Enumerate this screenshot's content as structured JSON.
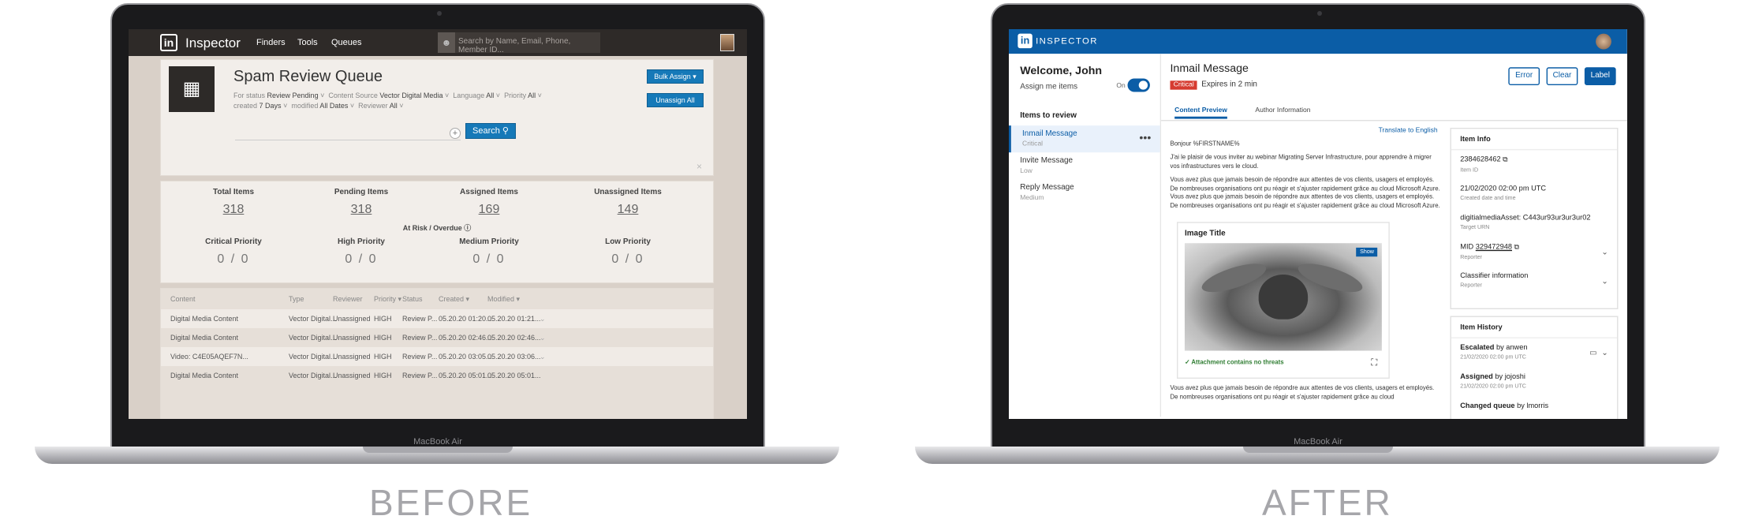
{
  "before": {
    "app_name": "Inspector",
    "logo_text": "in",
    "nav": [
      "Finders",
      "Tools",
      "Queues"
    ],
    "search_placeholder": "Search by Name, Email, Phone, Member ID...",
    "queue_title": "Spam Review Queue",
    "filters": {
      "for_status_label": "For status",
      "for_status_value": "Review Pending",
      "content_source_label": "Content Source",
      "content_source_value": "Vector Digital Media",
      "language_label": "Language",
      "language_value": "All",
      "priority_label": "Priority",
      "priority_value": "All",
      "created_label": "created",
      "created_value": "7 Days",
      "modified_label": "modified",
      "modified_value": "All Dates",
      "reviewer_label": "Reviewer",
      "reviewer_value": "All"
    },
    "search_button": "Search",
    "bulk_assign_button": "Bulk Assign",
    "unassign_all_button": "Unassign All",
    "close_icon": "×",
    "stats": [
      {
        "label": "Total Items",
        "value": "318"
      },
      {
        "label": "Pending Items",
        "value": "318"
      },
      {
        "label": "Assigned Items",
        "value": "169"
      },
      {
        "label": "Unassigned Items",
        "value": "149"
      }
    ],
    "risk_label": "At Risk / Overdue",
    "priorities": [
      {
        "label": "Critical Priority",
        "value": "0 / 0"
      },
      {
        "label": "High Priority",
        "value": "0 / 0"
      },
      {
        "label": "Medium Priority",
        "value": "0 / 0"
      },
      {
        "label": "Low Priority",
        "value": "0 / 0"
      }
    ],
    "table_headers": [
      "Content",
      "Type",
      "Reviewer",
      "Priority",
      "Status",
      "Created",
      "Modified"
    ],
    "rows": [
      [
        "Digital Media Content",
        "Vector Digital...",
        "Unassigned",
        "HIGH",
        "Review P...",
        "05.20.20 01:20...",
        "05.20.20 01:21..."
      ],
      [
        "Digital Media Content",
        "Vector Digital...",
        "Unassigned",
        "HIGH",
        "Review P...",
        "05.20.20 02:46...",
        "05.20.20 02:46..."
      ],
      [
        "Video: C4E05AQEF7N...",
        "Vector Digital...",
        "Unassigned",
        "HIGH",
        "Review P...",
        "05.20.20 03:05...",
        "05.20.20 03:06..."
      ],
      [
        "Digital Media Content",
        "Vector Digital...",
        "Unassigned",
        "HIGH",
        "Review P...",
        "05.20.20 05:01...",
        "05.20.20 05:01..."
      ]
    ],
    "laptop_label": "MacBook Air",
    "caption": "BEFORE"
  },
  "after": {
    "app_name": "INSPECTOR",
    "logo_text": "in",
    "welcome": "Welcome, John",
    "assign_me": "Assign me items",
    "toggle_label": "On",
    "items_to_review": "Items to review",
    "review_items": [
      {
        "title": "Inmail Message",
        "priority": "Critical"
      },
      {
        "title": "Invite Message",
        "priority": "Low"
      },
      {
        "title": "Reply Message",
        "priority": "Medium"
      }
    ],
    "more_icon": "•••",
    "message_title": "Inmail Message",
    "critical_badge": "Critical",
    "expires": "Expires in 2 min",
    "buttons": {
      "error": "Error",
      "clear": "Clear",
      "label": "Label"
    },
    "tabs": [
      "Content Preview",
      "Author Information"
    ],
    "translate": "Translate to English",
    "greeting": "Bonjour %FIRSTNAME%",
    "para1": "J'ai le plaisir de vous inviter au webinar Migrating Server Infrastructure, pour apprendre à migrer vos infrastructures vers le cloud.",
    "para2": "Vous avez plus que jamais besoin de répondre aux attentes de vos clients, usagers et employés. De nombreuses organisations ont pu réagir et s'ajuster rapidement grâce au cloud Microsoft Azure. Vous avez plus que jamais besoin de répondre aux attentes de vos clients, usagers et employés. De nombreuses organisations ont pu réagir et s'ajuster rapidement grâce au cloud Microsoft Azure.",
    "image_title": "Image Title",
    "show_button": "Show",
    "safe_text": "Attachment contains no threats",
    "para3": "Vous avez plus que jamais besoin de répondre aux attentes de vos clients, usagers et employés. De nombreuses organisations ont pu réagir et s'ajuster rapidement grâce au cloud",
    "item_info_title": "Item Info",
    "item_info": [
      {
        "value": "2384628462",
        "key": "Item ID"
      },
      {
        "value": "21/02/2020 02:00 pm UTC",
        "key": "Created date and time"
      },
      {
        "value": "digitialmediaAsset: C443ur93ur3ur3ur02",
        "key": "Target URN"
      },
      {
        "value_prefix": "MID ",
        "value": "329472948",
        "key": "Reporter"
      },
      {
        "value": "Classifier information",
        "key": "Reporter"
      }
    ],
    "history_title": "Item History",
    "history": [
      {
        "action": "Escalated",
        "by": "by",
        "user": "anwen",
        "time": "21/02/2020 02:00 pm UTC"
      },
      {
        "action": "Assigned",
        "by": "by",
        "user": "jojoshi",
        "time": "21/02/2020 02:00 pm UTC"
      },
      {
        "action": "Changed queue",
        "by": "by",
        "user": "lmorris",
        "time": ""
      }
    ],
    "laptop_label": "MacBook Air",
    "caption": "AFTER"
  }
}
